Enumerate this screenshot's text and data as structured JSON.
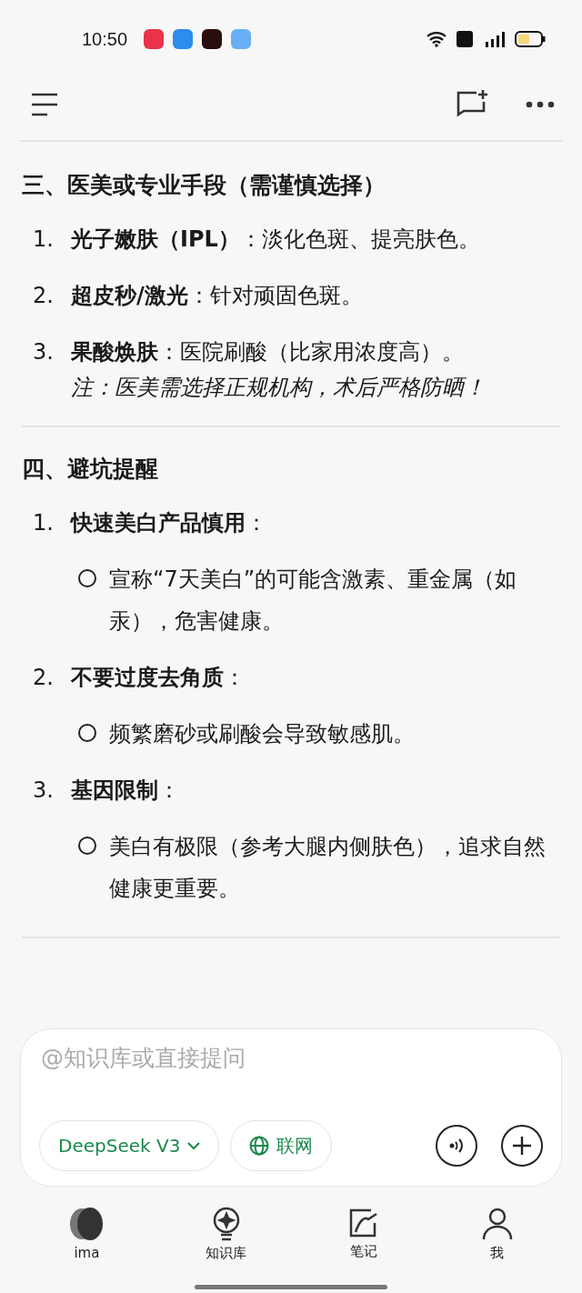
{
  "status_bar": {
    "time": "10:50"
  },
  "sections": [
    {
      "heading": "三、医美或专业手段（需谨慎选择）",
      "items": [
        {
          "number": "1.",
          "text": "**光子嫩肤（IPL）**：淡化色斑、提亮肤色。"
        },
        {
          "number": "2.",
          "text": "**超皮秒/激光**：针对顽固色斑。"
        },
        {
          "number": "3.",
          "text": "**果酸焕肤**：医院刷酸（比家用浓度高）。",
          "note": "注：医美需选择正规机构，术后严格防晒！"
        }
      ]
    },
    {
      "heading": "四、避坑提醒",
      "items": [
        {
          "number": "1.",
          "text": "**快速美白产品慎用**：",
          "bullets": [
            "宣称“7天美白”的可能含激素、重金属（如汞），危害健康。"
          ]
        },
        {
          "number": "2.",
          "text": "**不要过度去角质**：",
          "bullets": [
            "频繁磨砂或刷酸会导致敏感肌。"
          ]
        },
        {
          "number": "3.",
          "text": "**基因限制**：",
          "bullets": [
            "美白有极限（参考大腿内侧肤色），追求自然健康更重要。"
          ]
        }
      ]
    }
  ],
  "composer": {
    "placeholder": "@知识库或直接提问",
    "model": "DeepSeek V3",
    "web": "联网"
  },
  "nav": [
    {
      "label": "ima"
    },
    {
      "label": "知识库"
    },
    {
      "label": "笔记"
    },
    {
      "label": "我"
    }
  ]
}
